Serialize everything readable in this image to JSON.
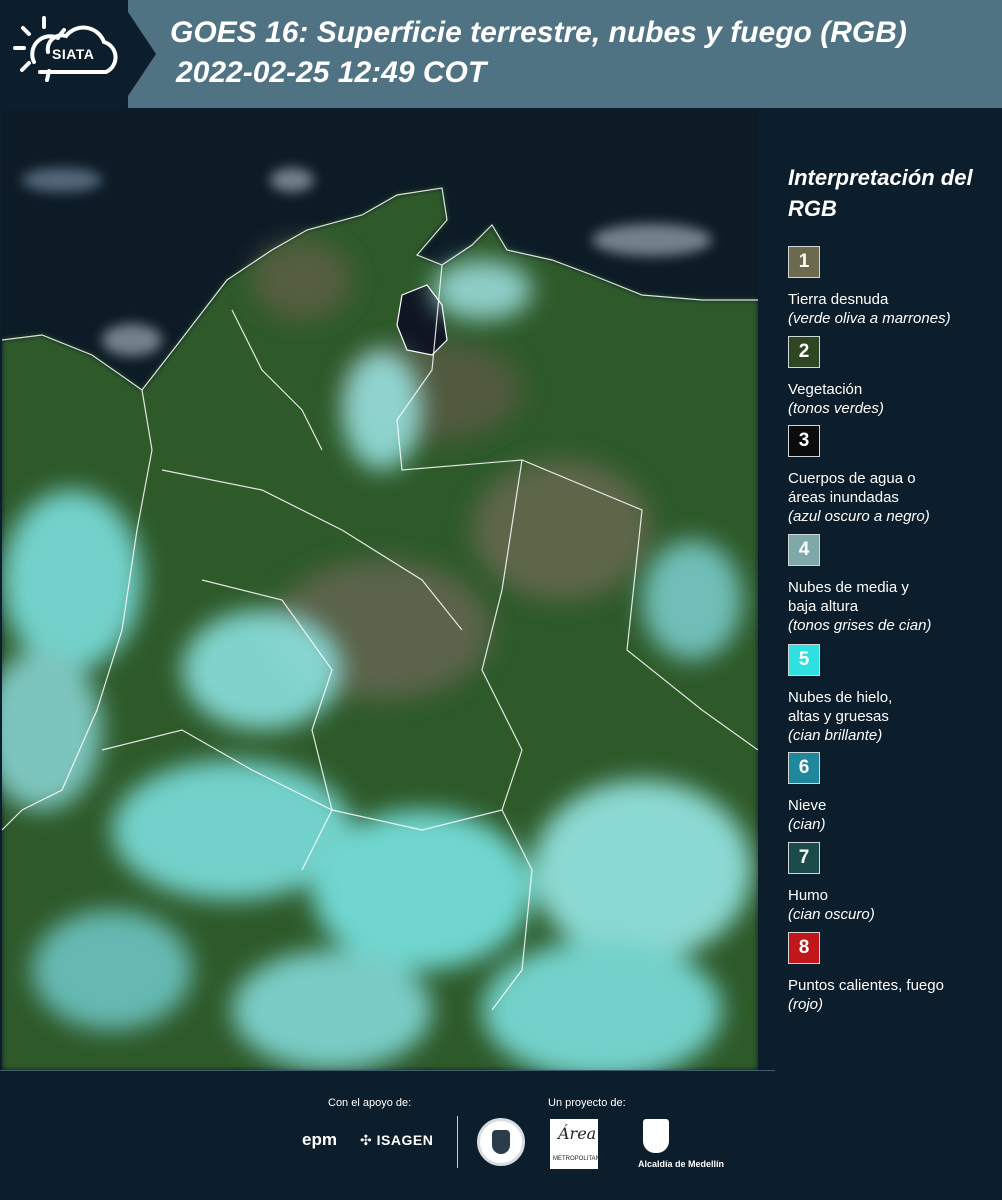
{
  "header": {
    "logo_text": "SIATA",
    "title": "GOES 16: Superficie terrestre, nubes y fuego (RGB)",
    "subtitle": "2022-02-25 12:49 COT"
  },
  "legend": {
    "title": "Interpretación del RGB",
    "items": [
      {
        "num": "1",
        "label": "Tierra desnuda",
        "sub": "(verde oliva a marrones)",
        "color": "#6b6a4c"
      },
      {
        "num": "2",
        "label": "Vegetación",
        "sub": "(tonos verdes)",
        "color": "#2f4623"
      },
      {
        "num": "3",
        "label": "Cuerpos de agua o\náreas inundadas",
        "sub": "(azul oscuro a negro)",
        "color": "#0b0b0d"
      },
      {
        "num": "4",
        "label": "Nubes de media y\nbaja altura",
        "sub": "(tonos grises de cian)",
        "color": "#7fa9a8"
      },
      {
        "num": "5",
        "label": "Nubes de hielo,\naltas y gruesas",
        "sub": "(cian brillante)",
        "color": "#2fe0e0"
      },
      {
        "num": "6",
        "label": "Nieve",
        "sub": "(cian)",
        "color": "#1f889c"
      },
      {
        "num": "7",
        "label": "Humo",
        "sub": "(cian oscuro)",
        "color": "#1a4a4a"
      },
      {
        "num": "8",
        "label": "Puntos calientes, fuego",
        "sub": "(rojo)",
        "color": "#c1161a"
      }
    ]
  },
  "footer": {
    "support_label": "Con el apoyo de:",
    "project_label": "Un proyecto de:",
    "epm": "epm",
    "isagen": "ISAGEN",
    "area_script": "Área",
    "area_small": "METROPOLITANA",
    "medellin": "Alcaldía de Medellín"
  },
  "colors": {
    "header_bg": "#4f7383",
    "panel_bg": "#0c1d2b",
    "ocean": "#0d1b26",
    "vegetation": "#2f5a2c",
    "cloud_cyan": "#7fe6e6",
    "bare_soil": "#6e6b55"
  }
}
